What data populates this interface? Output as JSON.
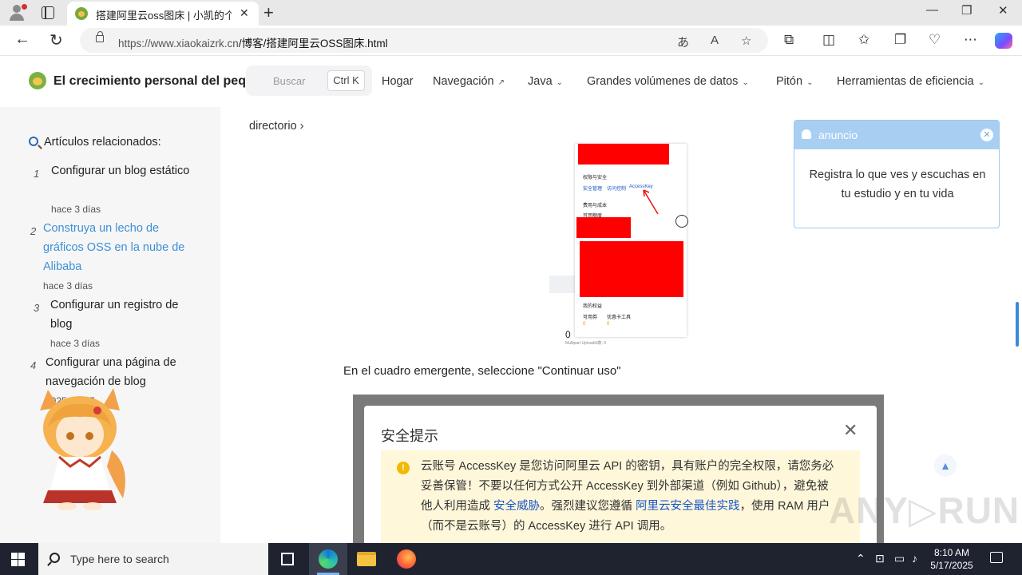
{
  "browser": {
    "tab_title": "搭建阿里云oss图床 | 小凯的个人博客",
    "url_host": "https://www.xiaokaizrk.cn",
    "url_path": "/博客/搭建阿里云OSS图床.html",
    "tab_close": "✕",
    "new_tab": "+",
    "window_controls": [
      "—",
      "❐",
      "✕"
    ]
  },
  "site": {
    "title": "El crecimiento personal del pequeño Kai",
    "search_placeholder": "Buscar",
    "search_shortcut": "Ctrl K",
    "menu": [
      {
        "label": "Hogar",
        "suffix": ""
      },
      {
        "label": "Navegación",
        "suffix": "↗"
      },
      {
        "label": "Java",
        "suffix": "⌄"
      },
      {
        "label": "Grandes volúmenes de datos",
        "suffix": "⌄"
      },
      {
        "label": "Pitón",
        "suffix": "⌄"
      },
      {
        "label": "Herramientas de eficiencia",
        "suffix": "⌄"
      }
    ]
  },
  "sidebar": {
    "heading": "Artículos relacionados:",
    "articles": [
      {
        "num": "1",
        "title": "Configurar un blog estático",
        "date": "hace 3 días"
      },
      {
        "num": "2",
        "title": "Construya un lecho de gráficos OSS en la nube de Alibaba",
        "date": "hace 3 días"
      },
      {
        "num": "3",
        "title": "Configurar un registro de blog",
        "date": "hace 3 días"
      },
      {
        "num": "4",
        "title": "Configurar una página de navegación de blog",
        "date": "2025-05-17"
      }
    ]
  },
  "content": {
    "directory": "directorio",
    "directory_chevron": "›",
    "paragraph": "En el cuadro emergente, seleccione \"Continuar uso\"",
    "screenshot": {
      "section1": "权限与安全",
      "links": [
        "安全管理",
        "访问控制",
        "AccessKey"
      ],
      "section2": "费用与成本",
      "line2": "可用额度",
      "section3": "我的权益",
      "cols": [
        "可用券",
        "优惠卡工具"
      ],
      "vals": [
        "0",
        "0"
      ],
      "bottom_num": "0",
      "bottom_text": "Multipart UploadId数: 0"
    },
    "dialog": {
      "title": "安全提示",
      "close": "✕",
      "warn_icon": "!",
      "warn_text_1": "云账号 AccessKey 是您访问阿里云 API 的密钥，具有账户的完全权限，请您务必妥善保管！不要以任何方式公开 AccessKey 到外部渠道（例如 Github），避免被他人利用造成 ",
      "warn_link_1": "安全威胁",
      "warn_text_2": "。强烈建议您遵循 ",
      "warn_link_2": "阿里云安全最佳实践",
      "warn_text_3": "，使用 RAM 用户（而不是云账号）的 AccessKey 进行 API 调用。"
    }
  },
  "notice": {
    "title": "anuncio",
    "close": "✕",
    "body": "Registra lo que ves y escuchas en tu estudio y en tu vida"
  },
  "watermark": "ANY▷RUN",
  "taskbar": {
    "search_placeholder": "Type here to search",
    "time": "8:10 AM",
    "date": "5/17/2025"
  },
  "colors": {
    "accent": "#3d8fd6",
    "notice_header": "#a8cff2",
    "warn_bg": "#fff7da",
    "taskbar": "#1f2330"
  }
}
